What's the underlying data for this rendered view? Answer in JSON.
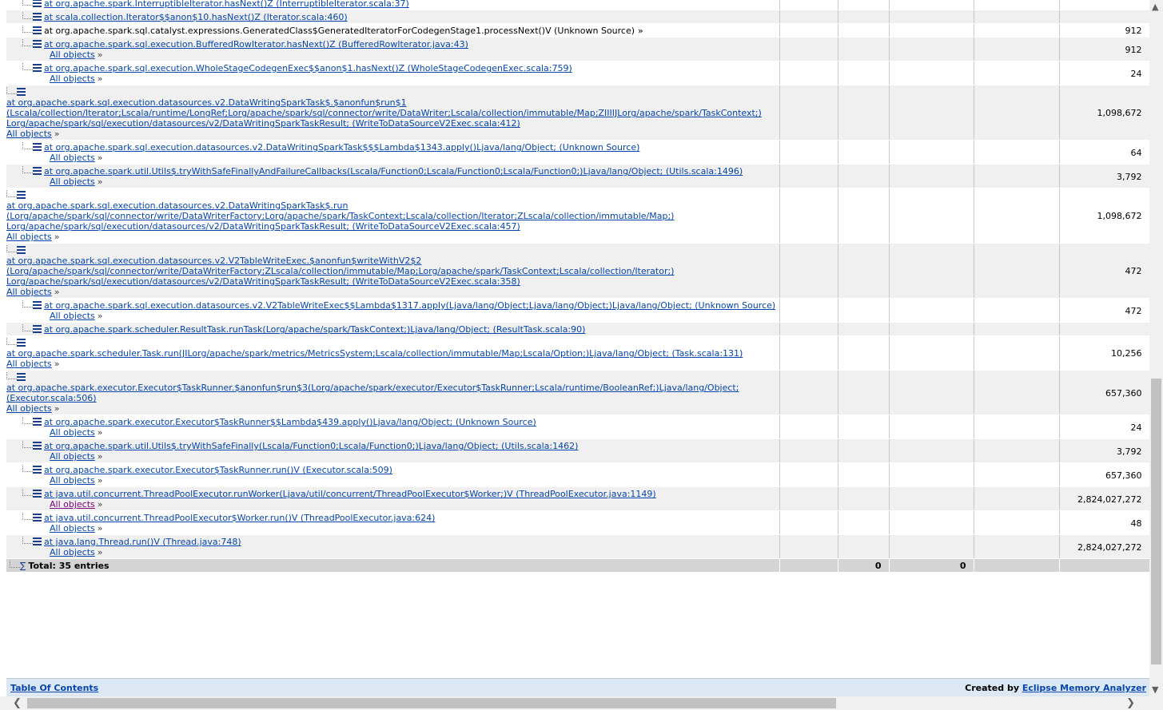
{
  "all_objects_label": "All objects",
  "all_objects_arrow": "»",
  "rows": [
    {
      "frame": "at org.apache.spark.InterruptibleIterator.hasNext()Z (InterruptibleIterator.scala:37)",
      "link": true,
      "indent": true,
      "all": false,
      "value": ""
    },
    {
      "frame": "at scala.collection.Iterator$$anon$10.hasNext()Z (Iterator.scala:460)",
      "link": true,
      "indent": true,
      "all": false,
      "value": ""
    },
    {
      "frame": "at org.apache.spark.sql.catalyst.expressions.GeneratedClass$GeneratedIteratorForCodegenStage1.processNext()V (Unknown Source)",
      "link": false,
      "indent": true,
      "all": false,
      "suffix": "»",
      "value": "912"
    },
    {
      "frame": "at org.apache.spark.sql.execution.BufferedRowIterator.hasNext()Z (BufferedRowIterator.java:43)",
      "link": true,
      "indent": true,
      "all": true,
      "value": "912"
    },
    {
      "frame": "at org.apache.spark.sql.execution.WholeStageCodegenExec$$anon$1.hasNext()Z (WholeStageCodegenExec.scala:759)",
      "link": true,
      "indent": true,
      "all": true,
      "value": "24"
    },
    {
      "frame": "at org.apache.spark.sql.execution.datasources.v2.DataWritingSparkTask$.$anonfun$run$1",
      "frame2": "(Lscala/collection/Iterator;Lscala/runtime/LongRef;Lorg/apache/spark/sql/connector/write/DataWriter;Lscala/collection/immutable/Map;ZIIIIJLorg/apache/spark/TaskContext;)",
      "frame3": "Lorg/apache/spark/sql/execution/datasources/v2/DataWritingSparkTaskResult; (WriteToDataSourceV2Exec.scala:412)",
      "link": true,
      "indent": false,
      "all": true,
      "value": "1,098,672"
    },
    {
      "frame": "at org.apache.spark.sql.execution.datasources.v2.DataWritingSparkTask$$$Lambda$1343.apply()Ljava/lang/Object; (Unknown Source)",
      "link": true,
      "indent": true,
      "all": true,
      "value": "64"
    },
    {
      "frame": "at org.apache.spark.util.Utils$.tryWithSafeFinallyAndFailureCallbacks(Lscala/Function0;Lscala/Function0;Lscala/Function0;)Ljava/lang/Object; (Utils.scala:1496)",
      "link": true,
      "indent": true,
      "all": true,
      "value": "3,792"
    },
    {
      "frame": "at org.apache.spark.sql.execution.datasources.v2.DataWritingSparkTask$.run",
      "frame2": "(Lorg/apache/spark/sql/connector/write/DataWriterFactory;Lorg/apache/spark/TaskContext;Lscala/collection/Iterator;ZLscala/collection/immutable/Map;)",
      "frame3": "Lorg/apache/spark/sql/execution/datasources/v2/DataWritingSparkTaskResult; (WriteToDataSourceV2Exec.scala:457)",
      "link": true,
      "indent": false,
      "all": true,
      "value": "1,098,672"
    },
    {
      "frame": "at org.apache.spark.sql.execution.datasources.v2.V2TableWriteExec.$anonfun$writeWithV2$2",
      "frame2": "(Lorg/apache/spark/sql/connector/write/DataWriterFactory;ZLscala/collection/immutable/Map;Lorg/apache/spark/TaskContext;Lscala/collection/Iterator;)",
      "frame3": "Lorg/apache/spark/sql/execution/datasources/v2/DataWritingSparkTaskResult; (WriteToDataSourceV2Exec.scala:358)",
      "link": true,
      "indent": false,
      "all": true,
      "value": "472"
    },
    {
      "frame": "at org.apache.spark.sql.execution.datasources.v2.V2TableWriteExec$$Lambda$1317.apply(Ljava/lang/Object;Ljava/lang/Object;)Ljava/lang/Object; (Unknown Source)",
      "link": true,
      "indent": true,
      "all": true,
      "value": "472"
    },
    {
      "frame": "at org.apache.spark.scheduler.ResultTask.runTask(Lorg/apache/spark/TaskContext;)Ljava/lang/Object; (ResultTask.scala:90)",
      "link": true,
      "indent": true,
      "all": false,
      "value": ""
    },
    {
      "frame": "at org.apache.spark.scheduler.Task.run(JILorg/apache/spark/metrics/MetricsSystem;Lscala/collection/immutable/Map;Lscala/Option;)Ljava/lang/Object; (Task.scala:131)",
      "link": true,
      "indent": false,
      "all": true,
      "value": "10,256"
    },
    {
      "frame": "at org.apache.spark.executor.Executor$TaskRunner.$anonfun$run$3(Lorg/apache/spark/executor/Executor$TaskRunner;Lscala/runtime/BooleanRef;)Ljava/lang/Object;",
      "frame2": "(Executor.scala:506)",
      "link": true,
      "indent": false,
      "all": true,
      "value": "657,360"
    },
    {
      "frame": "at org.apache.spark.executor.Executor$TaskRunner$$Lambda$439.apply()Ljava/lang/Object; (Unknown Source)",
      "link": true,
      "indent": true,
      "all": true,
      "value": "24"
    },
    {
      "frame": "at org.apache.spark.util.Utils$.tryWithSafeFinally(Lscala/Function0;Lscala/Function0;)Ljava/lang/Object; (Utils.scala:1462)",
      "link": true,
      "indent": true,
      "all": true,
      "value": "3,792"
    },
    {
      "frame": "at org.apache.spark.executor.Executor$TaskRunner.run()V (Executor.scala:509)",
      "link": true,
      "indent": true,
      "all": true,
      "value": "657,360"
    },
    {
      "frame": "at java.util.concurrent.ThreadPoolExecutor.runWorker(Ljava/util/concurrent/ThreadPoolExecutor$Worker;)V (ThreadPoolExecutor.java:1149)",
      "link": true,
      "indent": true,
      "all": true,
      "visited": true,
      "value": "2,824,027,272"
    },
    {
      "frame": "at java.util.concurrent.ThreadPoolExecutor$Worker.run()V (ThreadPoolExecutor.java:624)",
      "link": true,
      "indent": true,
      "all": true,
      "value": "48"
    },
    {
      "frame": "at java.lang.Thread.run()V (Thread.java:748)",
      "link": true,
      "indent": true,
      "all": true,
      "value": "2,824,027,272"
    }
  ],
  "total": {
    "label": "Total: 35 entries",
    "col3": "0",
    "col4": "0"
  },
  "footer": {
    "toc": "Table Of Contents",
    "created_by": "Created by",
    "analyzer": "Eclipse Memory Analyzer"
  },
  "icons": {
    "frame": "stack-frame-icon",
    "sigma": "∑",
    "up": "▲",
    "down": "▼",
    "left": "❮",
    "right": "❯"
  },
  "colors": {
    "link": "#0645ad",
    "visited": "#800080",
    "row_alt": "#f0f0f0",
    "total_bg": "#d4d4d4",
    "footer_bg": "#dce8f3"
  }
}
